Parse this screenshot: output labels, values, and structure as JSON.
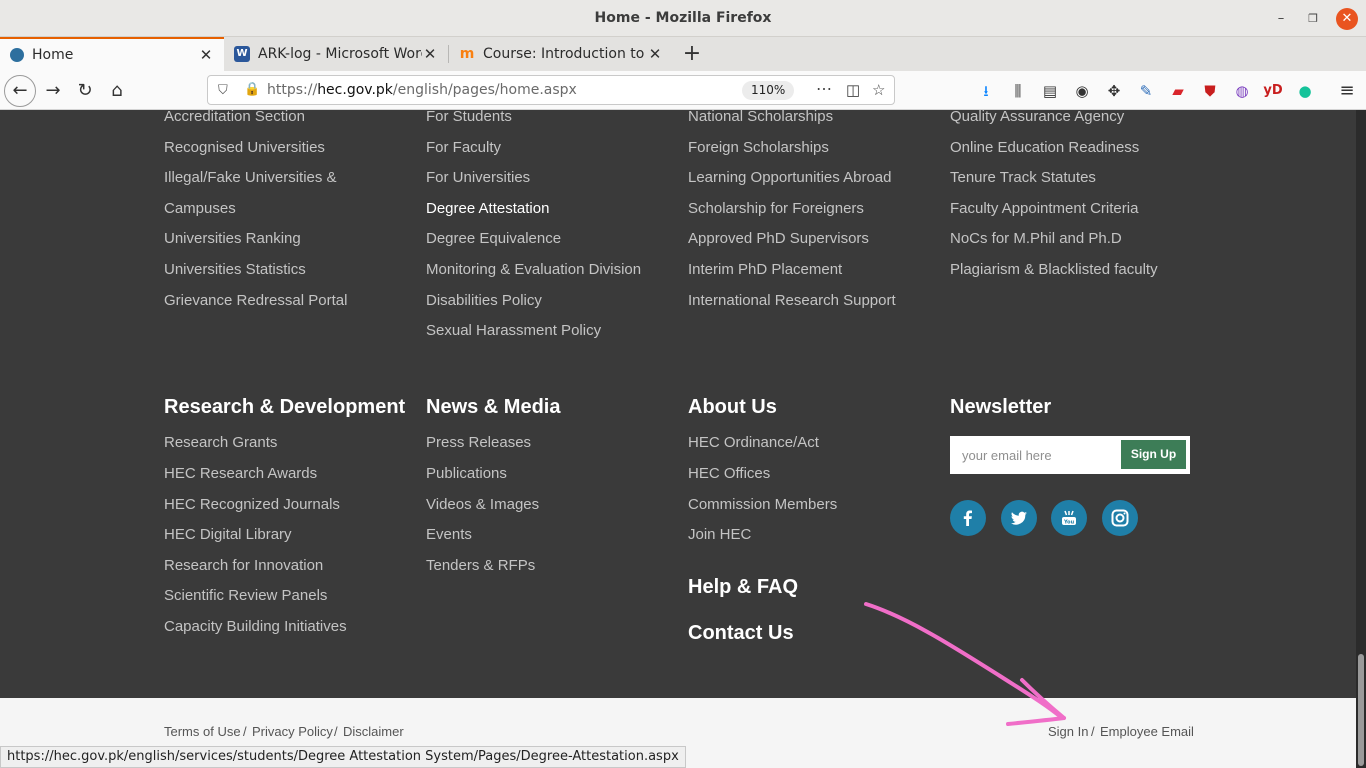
{
  "window": {
    "title": "Home - Mozilla Firefox"
  },
  "tabs": [
    {
      "label": "Home",
      "active": true
    },
    {
      "label": "ARK-log - Microsoft Word",
      "active": false
    },
    {
      "label": "Course: Introduction to H",
      "active": false
    }
  ],
  "urlbar": {
    "scheme": "https://",
    "host": "hec.gov.pk",
    "path": "/english/pages/home.aspx",
    "zoom": "110%"
  },
  "footer": {
    "top_columns": [
      [
        "Accreditation Section",
        "Recognised Universities",
        "Illegal/Fake Universities &",
        "Campuses",
        "Universities Ranking",
        "Universities Statistics",
        "Grievance Redressal Portal"
      ],
      [
        "For Students",
        "For Faculty",
        "For Universities",
        "Degree Attestation",
        "Degree Equivalence",
        "Monitoring & Evaluation Division",
        "Disabilities Policy",
        "Sexual Harassment Policy"
      ],
      [
        "National Scholarships",
        "Foreign Scholarships",
        "Learning Opportunities Abroad",
        "Scholarship for Foreigners",
        "Approved PhD Supervisors",
        "Interim PhD Placement",
        "International Research Support"
      ],
      [
        "Quality Assurance Agency",
        "Online Education Readiness",
        "Tenure Track Statutes",
        "Faculty Appointment Criteria",
        "NoCs for M.Phil and Ph.D",
        "Plagiarism & Blacklisted faculty"
      ]
    ],
    "research": {
      "heading": "Research & Development",
      "links": [
        "Research Grants",
        "HEC Research Awards",
        "HEC Recognized Journals",
        "HEC Digital Library",
        "Research for Innovation",
        "Scientific Review Panels",
        "Capacity Building Initiatives"
      ]
    },
    "news": {
      "heading": "News & Media",
      "links": [
        "Press Releases",
        "Publications",
        "Videos & Images",
        "Events",
        "Tenders & RFPs"
      ]
    },
    "about": {
      "heading": "About Us",
      "links": [
        "HEC Ordinance/Act",
        "HEC Offices",
        "Commission Members",
        "Join HEC"
      ],
      "help": "Help & FAQ",
      "contact": "Contact Us"
    },
    "newsletter": {
      "heading": "Newsletter",
      "placeholder": "your email here",
      "button": "Sign Up"
    },
    "social": [
      "facebook-icon",
      "twitter-icon",
      "youtube-icon",
      "instagram-icon"
    ],
    "social_color": "#1f7fa8"
  },
  "bottom": {
    "terms": "Terms of Use",
    "sep1": "/",
    "privacy": "Privacy Policy",
    "sep2": "/",
    "disclaimer": "Disclaimer",
    "signin": "Sign In",
    "sep3": "/",
    "employee": "Employee Email"
  },
  "statusbar": "https://hec.gov.pk/english/services/students/Degree Attestation System/Pages/Degree-Attestation.aspx",
  "colors": {
    "footer_bg": "#3a3a3a",
    "accent_green": "#3d7d57",
    "annotation_pink": "#f06ec8"
  }
}
